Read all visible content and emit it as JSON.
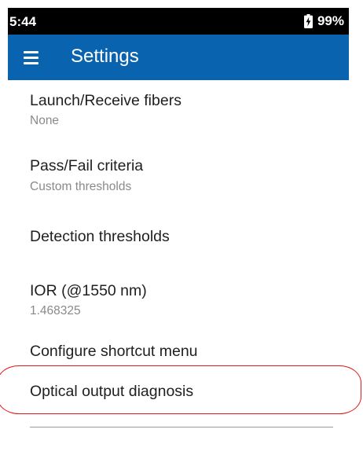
{
  "status_bar": {
    "time": "5:44",
    "battery_icon": "battery-charging-icon",
    "battery_percent": "99%"
  },
  "app_bar": {
    "menu_icon": "hamburger-menu-icon",
    "title": "Settings",
    "color": "#0a63ae"
  },
  "settings": {
    "items": [
      {
        "title": "Launch/Receive fibers",
        "summary": "None"
      },
      {
        "title": "Pass/Fail criteria",
        "summary": "Custom thresholds"
      },
      {
        "title": "Detection thresholds"
      },
      {
        "title": "IOR (@1550 nm)",
        "summary": "1.468325"
      },
      {
        "title": "Configure shortcut menu"
      },
      {
        "title": "Optical output diagnosis"
      }
    ]
  },
  "annotation": {
    "highlight_color": "#e11818"
  }
}
